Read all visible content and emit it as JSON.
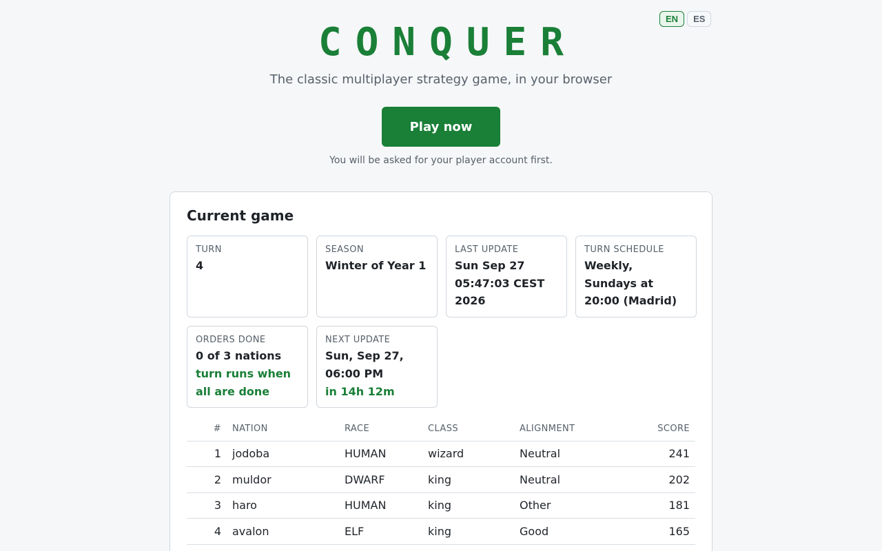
{
  "languages": [
    "EN",
    "ES"
  ],
  "active_language": "EN",
  "title": "CONQUER",
  "tagline": "The classic multiplayer strategy game, in your browser",
  "play_button": "Play now",
  "play_note": "You will be asked for your player account first.",
  "current_game": {
    "heading": "Current game",
    "tiles": [
      {
        "label": "TURN",
        "value": "4",
        "extra": ""
      },
      {
        "label": "SEASON",
        "value": "Winter of Year 1",
        "extra": ""
      },
      {
        "label": "LAST UPDATE",
        "value": "Sun Sep 27 05:47:03 CEST 2026",
        "extra": ""
      },
      {
        "label": "TURN SCHEDULE",
        "value": "Weekly, Sundays at 20:00 (Madrid)",
        "extra": ""
      },
      {
        "label": "ORDERS DONE",
        "value": "0 of 3 nations",
        "extra": "turn runs when all are done"
      },
      {
        "label": "NEXT UPDATE",
        "value": "Sun, Sep 27, 06:00 PM",
        "extra": "in 14h 12m"
      }
    ]
  },
  "table": {
    "headers": [
      "#",
      "NATION",
      "RACE",
      "CLASS",
      "ALIGNMENT",
      "SCORE"
    ],
    "rows": [
      [
        "1",
        "jodoba",
        "HUMAN",
        "wizard",
        "Neutral",
        "241"
      ],
      [
        "2",
        "muldor",
        "DWARF",
        "king",
        "Neutral",
        "202"
      ],
      [
        "3",
        "haro",
        "HUMAN",
        "king",
        "Other",
        "181"
      ],
      [
        "4",
        "avalon",
        "ELF",
        "king",
        "Good",
        "165"
      ]
    ]
  },
  "colors": {
    "accent": "#1a7f37",
    "background": "#f6f7f9"
  }
}
